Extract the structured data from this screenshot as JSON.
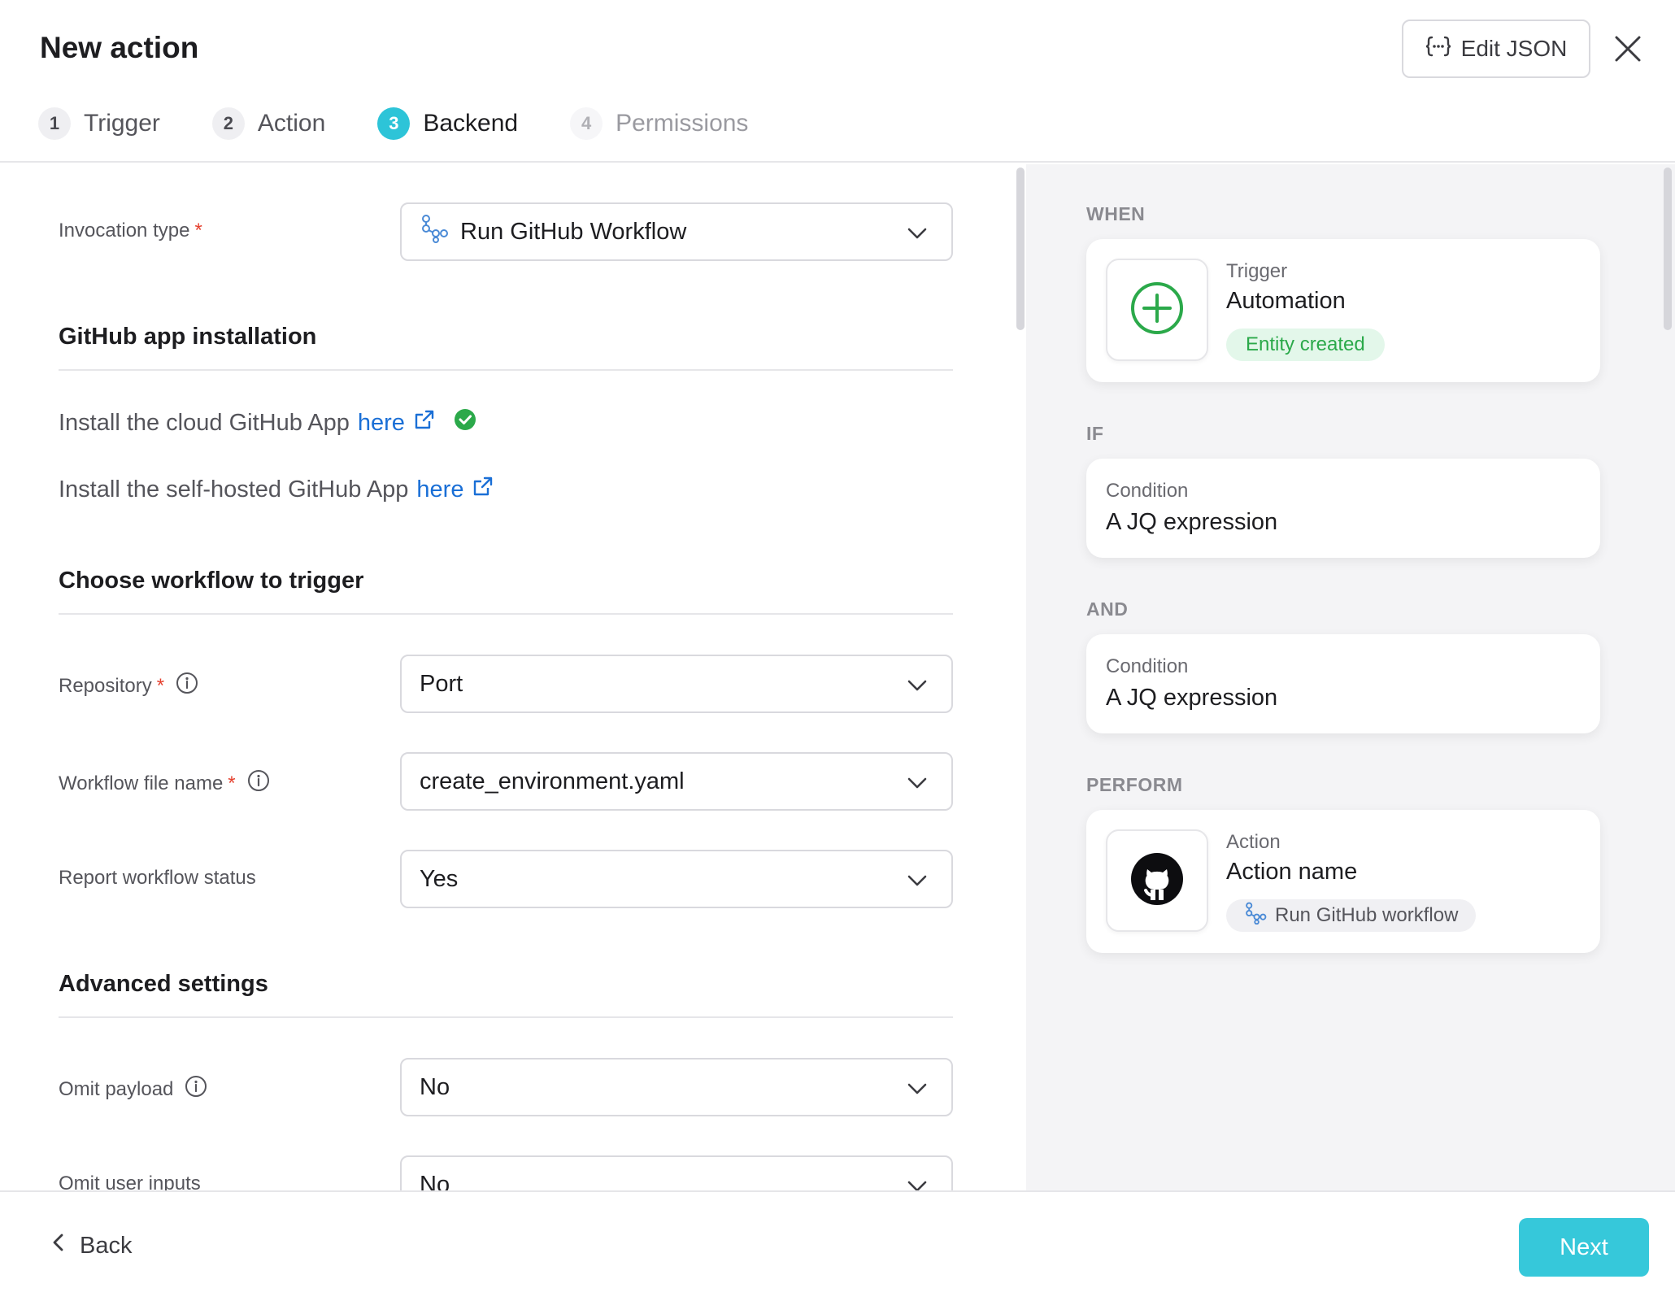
{
  "header": {
    "title": "New action",
    "edit_json_label": "Edit JSON"
  },
  "steps": [
    {
      "num": "1",
      "label": "Trigger",
      "state": "done"
    },
    {
      "num": "2",
      "label": "Action",
      "state": "done"
    },
    {
      "num": "3",
      "label": "Backend",
      "state": "active"
    },
    {
      "num": "4",
      "label": "Permissions",
      "state": "disabled"
    }
  ],
  "form": {
    "invocation_type": {
      "label": "Invocation type",
      "value": "Run GitHub Workflow"
    },
    "github_section": {
      "title": "GitHub app installation",
      "cloud_text": "Install the cloud GitHub App",
      "cloud_link": "here",
      "self_hosted_text": "Install the self-hosted GitHub App",
      "self_hosted_link": "here"
    },
    "workflow_section": {
      "title": "Choose workflow to trigger"
    },
    "repository": {
      "label": "Repository",
      "value": "Port"
    },
    "workflow_file": {
      "label": "Workflow file name",
      "value": "create_environment.yaml"
    },
    "report_status": {
      "label": "Report workflow status",
      "value": "Yes"
    },
    "advanced_section": {
      "title": "Advanced settings"
    },
    "omit_payload": {
      "label": "Omit payload",
      "value": "No"
    },
    "omit_user_inputs": {
      "label": "Omit user inputs",
      "value": "No"
    }
  },
  "preview": {
    "when": {
      "section": "WHEN",
      "kicker": "Trigger",
      "title": "Automation",
      "badge": "Entity created"
    },
    "if": {
      "section": "IF",
      "kicker": "Condition",
      "title": "A JQ expression"
    },
    "and": {
      "section": "AND",
      "kicker": "Condition",
      "title": "A JQ expression"
    },
    "perform": {
      "section": "PERFORM",
      "kicker": "Action",
      "title": "Action name",
      "badge": "Run GitHub workflow"
    }
  },
  "footer": {
    "back_label": "Back",
    "next_label": "Next"
  },
  "colors": {
    "accent": "#36c8da",
    "link": "#1a6fd6",
    "success": "#2ba94a",
    "required": "#e5412f"
  }
}
